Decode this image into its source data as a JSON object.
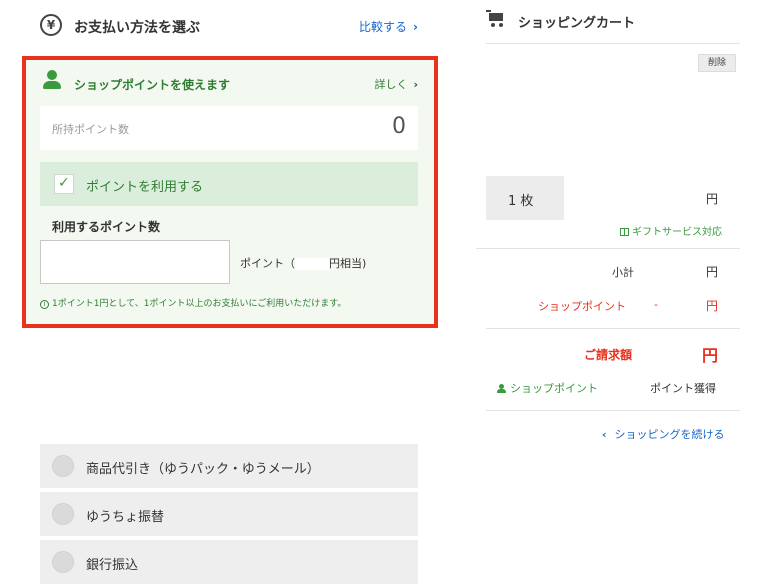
{
  "payment": {
    "title": "お支払い方法を選ぶ",
    "yen_symbol": "¥",
    "compare_link": "比較する",
    "chevron": "›",
    "methods": [
      {
        "label": "商品代引き（ゆうパック・ゆうメール）"
      },
      {
        "label": "ゆうちょ振替"
      },
      {
        "label": "銀行振込"
      }
    ]
  },
  "shop_points": {
    "title": "ショップポイントを使えます",
    "detail_link": "詳しく",
    "owned_label": "所持ポイント数",
    "owned_value": "0",
    "use_checkbox_label": "ポイントを利用する",
    "use_checked": true,
    "amount_label": "利用するポイント数",
    "input_value": "",
    "unit_prefix": "ポイント（",
    "unit_suffix": "円相当)",
    "note": "1ポイント1円として、1ポイント以上のお支払いにご利用いただけます。"
  },
  "cart": {
    "title": "ショッピングカート",
    "delete_button": "削除",
    "quantity": "1 枚",
    "item_price_unit": "円",
    "gift_service": "ギフトサービス対応",
    "subtotal_label": "小計",
    "subtotal_value": "円",
    "shop_point_label": "ショップポイント",
    "shop_point_dash": "-",
    "shop_point_value": "円",
    "billing_label": "ご請求額",
    "billing_value": "円",
    "points_label": "ショップポイント",
    "points_earned": "ポイント獲得",
    "continue_link": "ショッピングを続ける",
    "back_chevron": "‹"
  },
  "colors": {
    "highlight_border": "#e8321e",
    "accent_green": "#3a9a3e",
    "link_blue": "#1a66c9",
    "alert_red": "#e8321e"
  }
}
